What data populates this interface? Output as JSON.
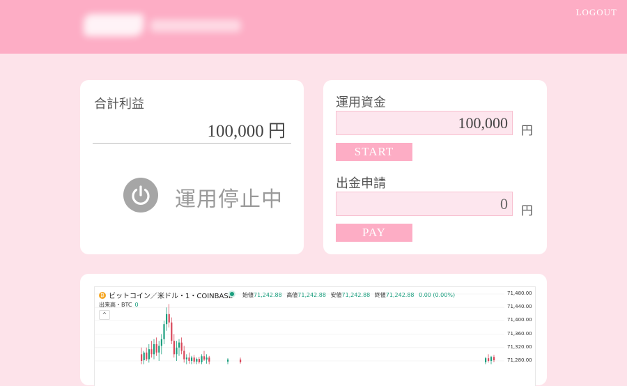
{
  "header": {
    "logout_label": "LOGOUT"
  },
  "profit_card": {
    "label": "合計利益",
    "value": "100,000 円",
    "status": "運用停止中"
  },
  "fund_card": {
    "fund_label": "運用資金",
    "fund_value": "100,000",
    "unit": "円",
    "start_label": "START",
    "withdraw_label": "出金申請",
    "withdraw_value": "0",
    "pay_label": "PAY"
  },
  "chart": {
    "symbol": "ビットコイン／米ドル・1・COINBASE",
    "btc_glyph": "₿",
    "ohlc": [
      {
        "label": "始値",
        "value": "71,242.88"
      },
      {
        "label": "高値",
        "value": "71,242.88"
      },
      {
        "label": "安値",
        "value": "71,242.88"
      },
      {
        "label": "終値",
        "value": "71,242.88"
      },
      {
        "label": "",
        "value": "0.00 (0.00%)"
      }
    ],
    "volume_label": "出来高・BTC",
    "volume_value": "0",
    "collapse_glyph": "^",
    "up_color": "#1a9e7e",
    "down_color": "#d9475a"
  },
  "chart_data": {
    "type": "candlestick",
    "title": "ビットコイン／米ドル・1・COINBASE",
    "y_ticks": [
      "71,480.00",
      "71,440.00",
      "71,400.00",
      "71,360.00",
      "71,320.00",
      "71,280.00"
    ],
    "ylim": [
      71270,
      71490
    ],
    "candles": [
      {
        "open": 71300,
        "high": 71320,
        "low": 71270,
        "close": 71280
      },
      {
        "open": 71282,
        "high": 71310,
        "low": 71270,
        "close": 71305
      },
      {
        "open": 71305,
        "high": 71320,
        "low": 71280,
        "close": 71285
      },
      {
        "open": 71285,
        "high": 71330,
        "low": 71275,
        "close": 71315
      },
      {
        "open": 71315,
        "high": 71340,
        "low": 71290,
        "close": 71300
      },
      {
        "open": 71300,
        "high": 71345,
        "low": 71285,
        "close": 71330
      },
      {
        "open": 71330,
        "high": 71350,
        "low": 71295,
        "close": 71305
      },
      {
        "open": 71305,
        "high": 71340,
        "low": 71280,
        "close": 71325
      },
      {
        "open": 71325,
        "high": 71360,
        "low": 71300,
        "close": 71345
      },
      {
        "open": 71345,
        "high": 71400,
        "low": 71330,
        "close": 71390
      },
      {
        "open": 71390,
        "high": 71440,
        "low": 71370,
        "close": 71420
      },
      {
        "open": 71420,
        "high": 71450,
        "low": 71380,
        "close": 71395
      },
      {
        "open": 71395,
        "high": 71410,
        "low": 71330,
        "close": 71340
      },
      {
        "open": 71340,
        "high": 71360,
        "low": 71290,
        "close": 71300
      },
      {
        "open": 71300,
        "high": 71340,
        "low": 71280,
        "close": 71320
      },
      {
        "open": 71320,
        "high": 71345,
        "low": 71295,
        "close": 71335
      },
      {
        "open": 71335,
        "high": 71350,
        "low": 71300,
        "close": 71310
      },
      {
        "open": 71310,
        "high": 71325,
        "low": 71275,
        "close": 71285
      },
      {
        "open": 71285,
        "high": 71300,
        "low": 71270,
        "close": 71290
      },
      {
        "open": 71290,
        "high": 71305,
        "low": 71272,
        "close": 71280
      },
      {
        "open": 71280,
        "high": 71295,
        "low": 71270,
        "close": 71290
      },
      {
        "open": 71290,
        "high": 71298,
        "low": 71272,
        "close": 71278
      },
      {
        "open": 71278,
        "high": 71290,
        "low": 71270,
        "close": 71286
      },
      {
        "open": 71286,
        "high": 71292,
        "low": 71272,
        "close": 71276
      },
      {
        "open": 71276,
        "high": 71300,
        "low": 71270,
        "close": 71294
      },
      {
        "open": 71294,
        "high": 71310,
        "low": 71280,
        "close": 71284
      },
      {
        "open": 71284,
        "high": 71300,
        "low": 71272,
        "close": 71290
      },
      {
        "open": 71290,
        "high": 71295,
        "low": 71270,
        "close": 71278
      },
      {
        "open": 71278,
        "high": 71288,
        "low": 71270,
        "close": 71284
      },
      {
        "open": 71284,
        "high": 71290,
        "low": 71272,
        "close": 71276
      },
      {
        "open": 71276,
        "high": 71292,
        "low": 71270,
        "close": 71288
      },
      {
        "open": 71288,
        "high": 71300,
        "low": 71275,
        "close": 71280
      },
      {
        "open": 71280,
        "high": 71295,
        "low": 71270,
        "close": 71292
      },
      {
        "open": 71292,
        "high": 71298,
        "low": 71276,
        "close": 71282
      }
    ]
  }
}
